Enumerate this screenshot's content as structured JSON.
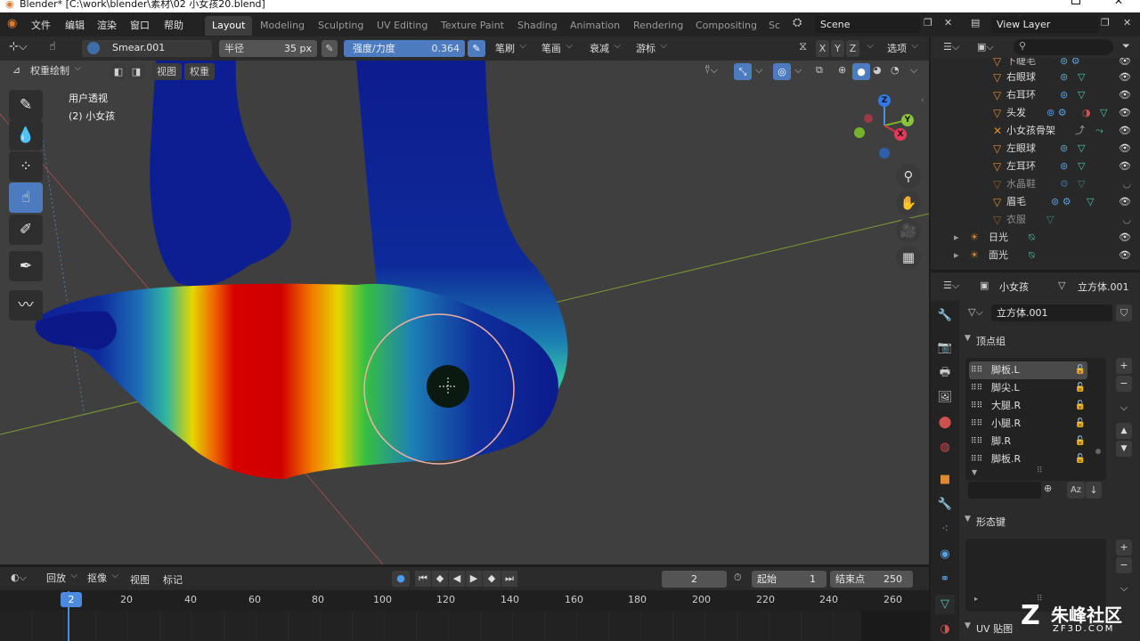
{
  "window": {
    "title": "Blender* [C:\\work\\blender\\素材\\02 小女孩20.blend]"
  },
  "menu": [
    "文件",
    "编辑",
    "渲染",
    "窗口",
    "帮助"
  ],
  "workspaces": [
    "Layout",
    "Modeling",
    "Sculpting",
    "UV Editing",
    "Texture Paint",
    "Shading",
    "Animation",
    "Rendering",
    "Compositing",
    "Sc"
  ],
  "scene": {
    "name": "Scene",
    "view_layer": "View Layer"
  },
  "tool_header": {
    "brush_name": "Smear.001",
    "radius_label": "半径",
    "radius_value": "35 px",
    "strength_label": "强度/力度",
    "strength_value": "0.364",
    "menus": [
      "笔刷",
      "笔画",
      "衰减",
      "游标"
    ],
    "axes": [
      "X",
      "Y",
      "Z"
    ],
    "options": "选项"
  },
  "viewport_header": {
    "mode": "权重绘制",
    "view": "视图",
    "weights": "权重"
  },
  "viewport": {
    "perspective": "用户透视",
    "object": "(2) 小女孩"
  },
  "gizmo": {
    "z": "Z",
    "y": "Y",
    "x": "X"
  },
  "outliner": {
    "partial_top": "下睫毛",
    "rows": [
      "右眼球",
      "右耳环",
      "头发",
      "小女孩骨架",
      "左眼球",
      "左耳环",
      "水晶鞋",
      "眉毛",
      "衣服"
    ],
    "lights": [
      "日光",
      "面光"
    ]
  },
  "properties": {
    "object": "小女孩",
    "mesh": "立方体.001",
    "mesh_field": "立方体.001",
    "vertex_groups_title": "顶点组",
    "vertex_groups": [
      "脚板.L",
      "脚尖.L",
      "大腿.R",
      "小腿.R",
      "脚.R",
      "脚板.R"
    ],
    "shape_keys_title": "形态键",
    "uv_title": "UV 贴图"
  },
  "timeline": {
    "menus": [
      "回放",
      "抠像",
      "视图",
      "标记"
    ],
    "current_frame": "2",
    "start_label": "起始",
    "start": "1",
    "end_label": "结束点",
    "end": "250",
    "ticks": [
      "20",
      "40",
      "60",
      "80",
      "100",
      "120",
      "140",
      "160",
      "180",
      "200",
      "220",
      "240",
      "260"
    ],
    "playhead": "2"
  },
  "watermark": {
    "brand": "朱峰社区",
    "url": "ZF3D.COM"
  },
  "colors": {
    "accent": "#4c7cbf",
    "orange": "#e08a30",
    "cyan": "#4fc9b0"
  }
}
